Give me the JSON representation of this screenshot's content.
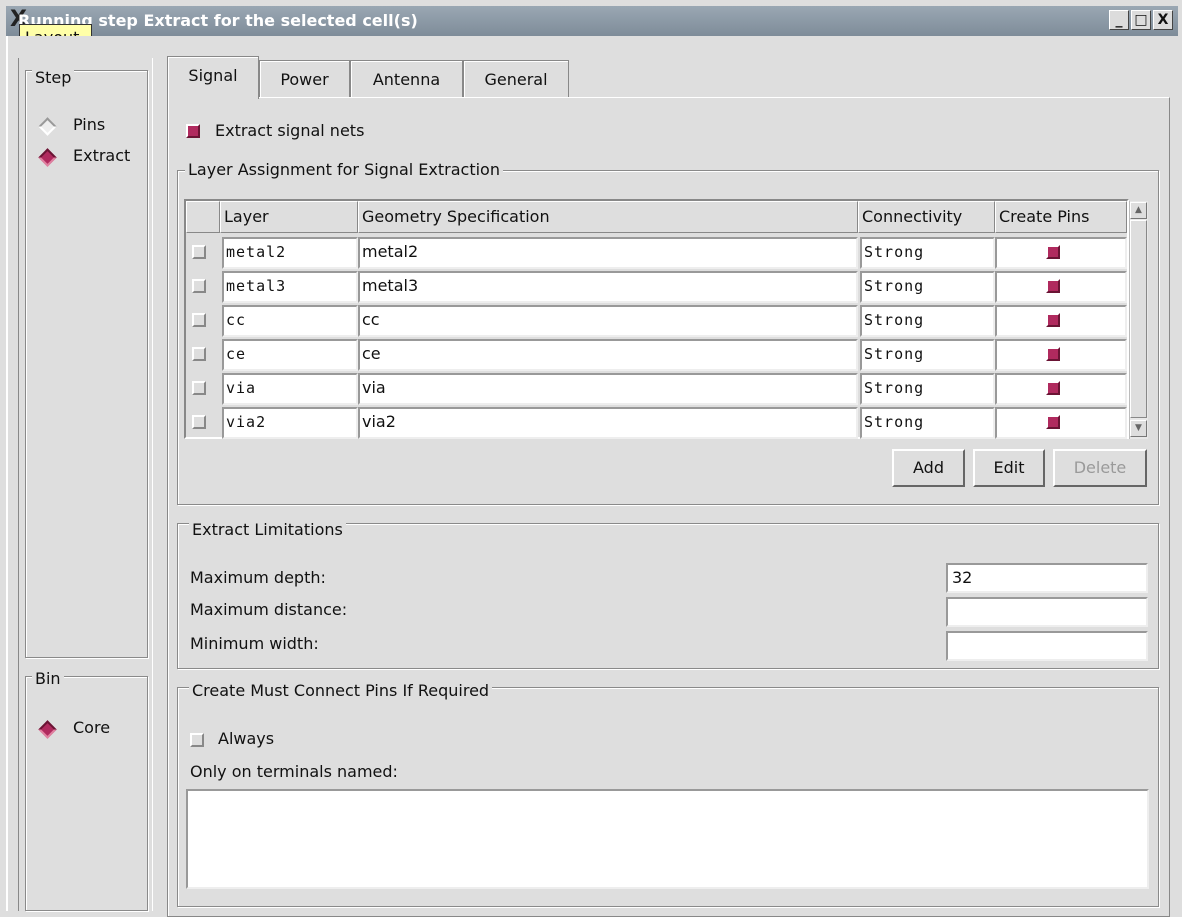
{
  "window": {
    "title": "Running step Extract for the selected cell(s)",
    "tooltip": "Layout",
    "controls": [
      "_",
      "□",
      "X"
    ]
  },
  "step": {
    "legend": "Step",
    "options": [
      {
        "label": "Pins",
        "selected": false
      },
      {
        "label": "Extract",
        "selected": true
      }
    ]
  },
  "bin": {
    "legend": "Bin",
    "options": [
      {
        "label": "Core",
        "selected": true
      }
    ]
  },
  "tabs": [
    {
      "label": "Signal",
      "active": true
    },
    {
      "label": "Power",
      "active": false
    },
    {
      "label": "Antenna",
      "active": false
    },
    {
      "label": "General",
      "active": false
    }
  ],
  "signal": {
    "extract_label": "Extract signal nets",
    "extract_checked": true,
    "layer_group_legend": "Layer Assignment for Signal Extraction",
    "columns": [
      "Layer",
      "Geometry Specification",
      "Connectivity",
      "Create Pins"
    ],
    "rows": [
      {
        "layer": "metal2",
        "geometry": "metal2",
        "connectivity": "Strong",
        "create_pins": true
      },
      {
        "layer": "metal3",
        "geometry": "metal3",
        "connectivity": "Strong",
        "create_pins": true
      },
      {
        "layer": "cc",
        "geometry": "cc",
        "connectivity": "Strong",
        "create_pins": true
      },
      {
        "layer": "ce",
        "geometry": "ce",
        "connectivity": "Strong",
        "create_pins": true
      },
      {
        "layer": "via",
        "geometry": "via",
        "connectivity": "Strong",
        "create_pins": true
      },
      {
        "layer": "via2",
        "geometry": "via2",
        "connectivity": "Strong",
        "create_pins": true
      }
    ],
    "buttons": {
      "add": "Add",
      "edit": "Edit",
      "delete": "Delete"
    }
  },
  "limits": {
    "legend": "Extract Limitations",
    "max_depth_label": "Maximum depth:",
    "max_depth_value": "32",
    "max_distance_label": "Maximum distance:",
    "max_distance_value": "",
    "min_width_label": "Minimum width:",
    "min_width_value": ""
  },
  "must_connect": {
    "legend": "Create Must Connect Pins If Required",
    "always_label": "Always",
    "always_checked": false,
    "terminals_label": "Only on terminals named:",
    "terminals_value": ""
  }
}
